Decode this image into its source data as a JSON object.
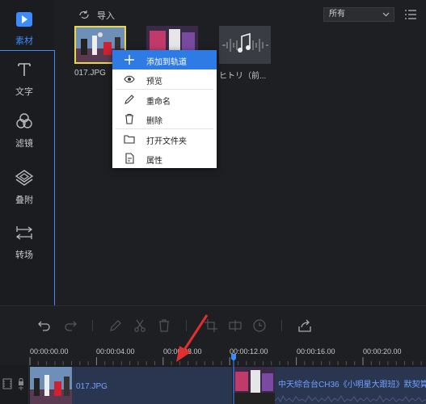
{
  "sidebar": {
    "items": [
      {
        "id": "media",
        "label": "素材",
        "icon": "media-play-icon",
        "active": true
      },
      {
        "id": "text",
        "label": "文字",
        "icon": "text-T-icon"
      },
      {
        "id": "filter",
        "label": "滤镜",
        "icon": "filter-circles-icon"
      },
      {
        "id": "overlay",
        "label": "叠附",
        "icon": "overlay-layers-icon"
      },
      {
        "id": "transition",
        "label": "转场",
        "icon": "transition-arrows-icon"
      }
    ]
  },
  "topbar": {
    "import_label": "导入",
    "filter_value": "所有"
  },
  "media": [
    {
      "name": "017.JPG",
      "selected": true
    },
    {
      "name": ""
    },
    {
      "name": "ヒトリ（前..."
    }
  ],
  "context_menu": {
    "items": [
      {
        "label": "添加到轨道",
        "icon": "plus-icon"
      },
      {
        "label": "预览",
        "icon": "eye-icon"
      },
      {
        "label": "重命名",
        "icon": "pencil-icon"
      },
      {
        "label": "删除",
        "icon": "trash-icon"
      },
      {
        "label": "打开文件夹",
        "icon": "folder-icon"
      },
      {
        "label": "属性",
        "icon": "document-icon"
      }
    ]
  },
  "timeline": {
    "time_labels": [
      "00:00:00.00",
      "00:00:04.00",
      "00:00:08.00",
      "00:00:12.00",
      "00:00:16.00",
      "00:00:20.00"
    ],
    "clips": [
      {
        "name": "017.JPG"
      },
      {
        "name": "中天綜合台CH36《小明星大跟班》默契算..."
      }
    ]
  },
  "colors": {
    "accent": "#3a8cff",
    "menu_highlight": "#2e7be6",
    "selection": "#e6d84a",
    "annotation_arrow": "#e03030"
  }
}
